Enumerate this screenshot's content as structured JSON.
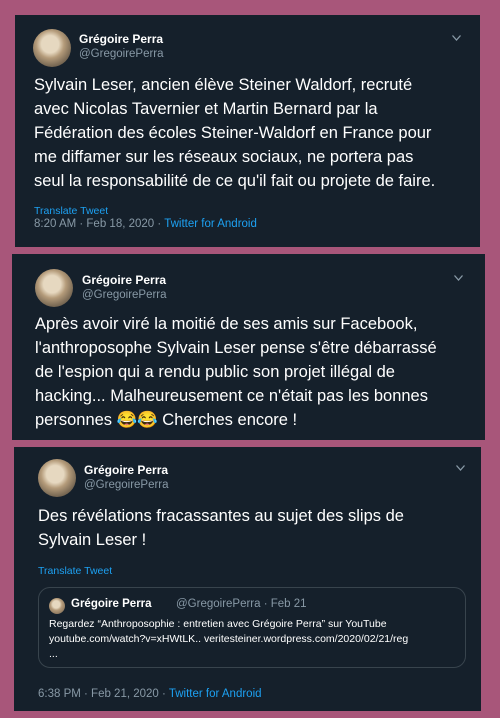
{
  "tweets": [
    {
      "name": "Grégoire Perra",
      "handle": "@GregoirePerra",
      "lines": [
        "Sylvain Leser, ancien élève Steiner Waldorf,  recruté",
        "avec Nicolas Tavernier et Martin Bernard par la",
        "Fédération des écoles Steiner-Waldorf en France pour",
        "me diffamer sur les réseaux sociaux,  ne portera pas",
        "seul la responsabilité de ce qu'il fait ou projete de faire."
      ],
      "translate": "Translate Tweet",
      "time": "8:20 AM · Feb 18, 2020 · ",
      "source": "Twitter for Android"
    },
    {
      "name": "Grégoire Perra",
      "handle": "@GregoirePerra",
      "lines": [
        "Après avoir viré la moitié de ses amis sur Facebook,",
        "l'anthroposophe Sylvain Leser pense s'être débarrassé",
        "de l'espion qui a rendu public son projet illégal de",
        "hacking... Malheureusement ce n'était pas les bonnes",
        "personnes 😂😂 Cherches encore !"
      ]
    },
    {
      "name": "Grégoire Perra",
      "handle": "@GregoirePerra",
      "lines": [
        "Des révélations fracassantes au sujet des slips de",
        "Sylvain Leser !"
      ],
      "translate": "Translate Tweet",
      "quote": {
        "name": "Grégoire Perra",
        "handle": "@GregoirePerra · Feb 21",
        "lines": [
          "Regardez “Anthroposophie : entretien avec Grégoire Perra” sur YouTube",
          "youtube.com/watch?v=xHWtLK.. veritesteiner.wordpress.com/2020/02/21/reg",
          "..."
        ]
      },
      "time": "6:38 PM · Feb 21, 2020 · ",
      "source": "Twitter for Android"
    }
  ],
  "icons": {
    "more": "chevron-down-icon",
    "avatar": "profile-photo"
  },
  "colors": {
    "background": "#a8567a",
    "card": "#15202b",
    "link": "#1da1f2",
    "muted": "#8899a6"
  }
}
